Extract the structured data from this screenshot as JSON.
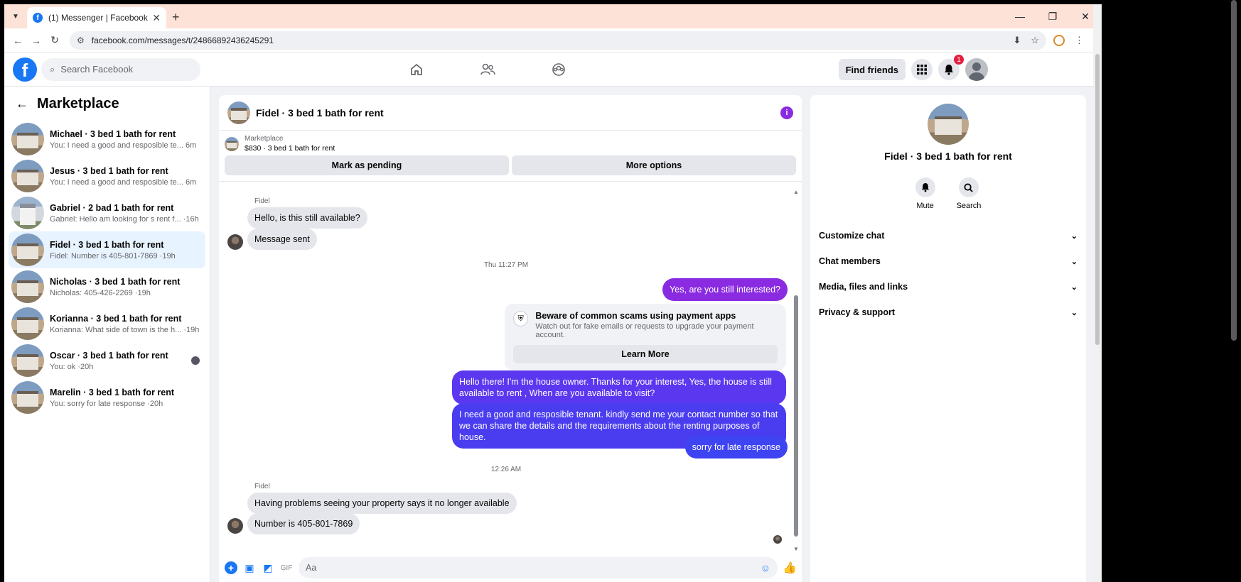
{
  "browser": {
    "tab_title": "(1) Messenger | Facebook",
    "url": "facebook.com/messages/t/24866892436245291"
  },
  "fb": {
    "search_placeholder": "Search Facebook",
    "find_friends": "Find friends",
    "notif_count": "1"
  },
  "sidebar": {
    "title": "Marketplace",
    "conversations": [
      {
        "name": "Michael · 3 bed 1 bath for rent",
        "preview": "You: I need a good and resposible te...  6m"
      },
      {
        "name": "Jesus · 3 bed 1 bath for rent",
        "preview": "You: I need a good and resposible te...  6m"
      },
      {
        "name": "Gabriel · 2 bad 1 bath for rent",
        "preview": "Gabriel: Hello am looking for s rent f... ·16h"
      },
      {
        "name": "Fidel · 3 bed 1 bath for rent",
        "preview": "Fidel: Number is 405-801-7869 ·19h"
      },
      {
        "name": "Nicholas · 3 bed 1 bath for rent",
        "preview": "Nicholas: 405-426-2269 ·19h"
      },
      {
        "name": "Korianna · 3 bed 1 bath for rent",
        "preview": "Korianna: What side of town is the h... ·19h"
      },
      {
        "name": "Oscar · 3 bed 1 bath for rent",
        "preview": "You: ok ·20h"
      },
      {
        "name": "Marelin · 3 bed 1 bath for rent",
        "preview": "You: sorry for late response ·20h"
      }
    ]
  },
  "chat": {
    "title": "Fidel · 3 bed 1 bath for rent",
    "marketplace_label": "Marketplace",
    "listing": "$830 · 3 bed 1 bath for rent",
    "mark_pending": "Mark as pending",
    "more_options": "More options",
    "sender_name": "Fidel",
    "msg_in_1": "Hello, is this still available?",
    "msg_in_2": "Message sent",
    "time_1": "Thu 11:27 PM",
    "msg_out_1": "Yes, are you still interested?",
    "scam_title": "Beware of common scams using payment apps",
    "scam_sub": "Watch out for fake emails or requests to upgrade your payment account.",
    "learn_more": "Learn More",
    "msg_out_2": "Hello there! I'm the house owner. Thanks for your interest, Yes, the house is still available to rent , When are you available to visit?",
    "msg_out_3": "I need a good and resposible tenant.  kindly send me your contact number so that we can share the details and the requirements about the renting purposes of house.",
    "msg_out_4": "sorry for late response",
    "time_2": "12:26 AM",
    "msg_in_3": "Having problems seeing your property says it no longer available",
    "msg_in_4": "Number is 405-801-7869",
    "composer_placeholder": "Aa"
  },
  "details": {
    "name": "Fidel · 3 bed 1 bath for rent",
    "mute": "Mute",
    "search": "Search",
    "sections": [
      "Customize chat",
      "Chat members",
      "Media, files and links",
      "Privacy & support"
    ]
  }
}
